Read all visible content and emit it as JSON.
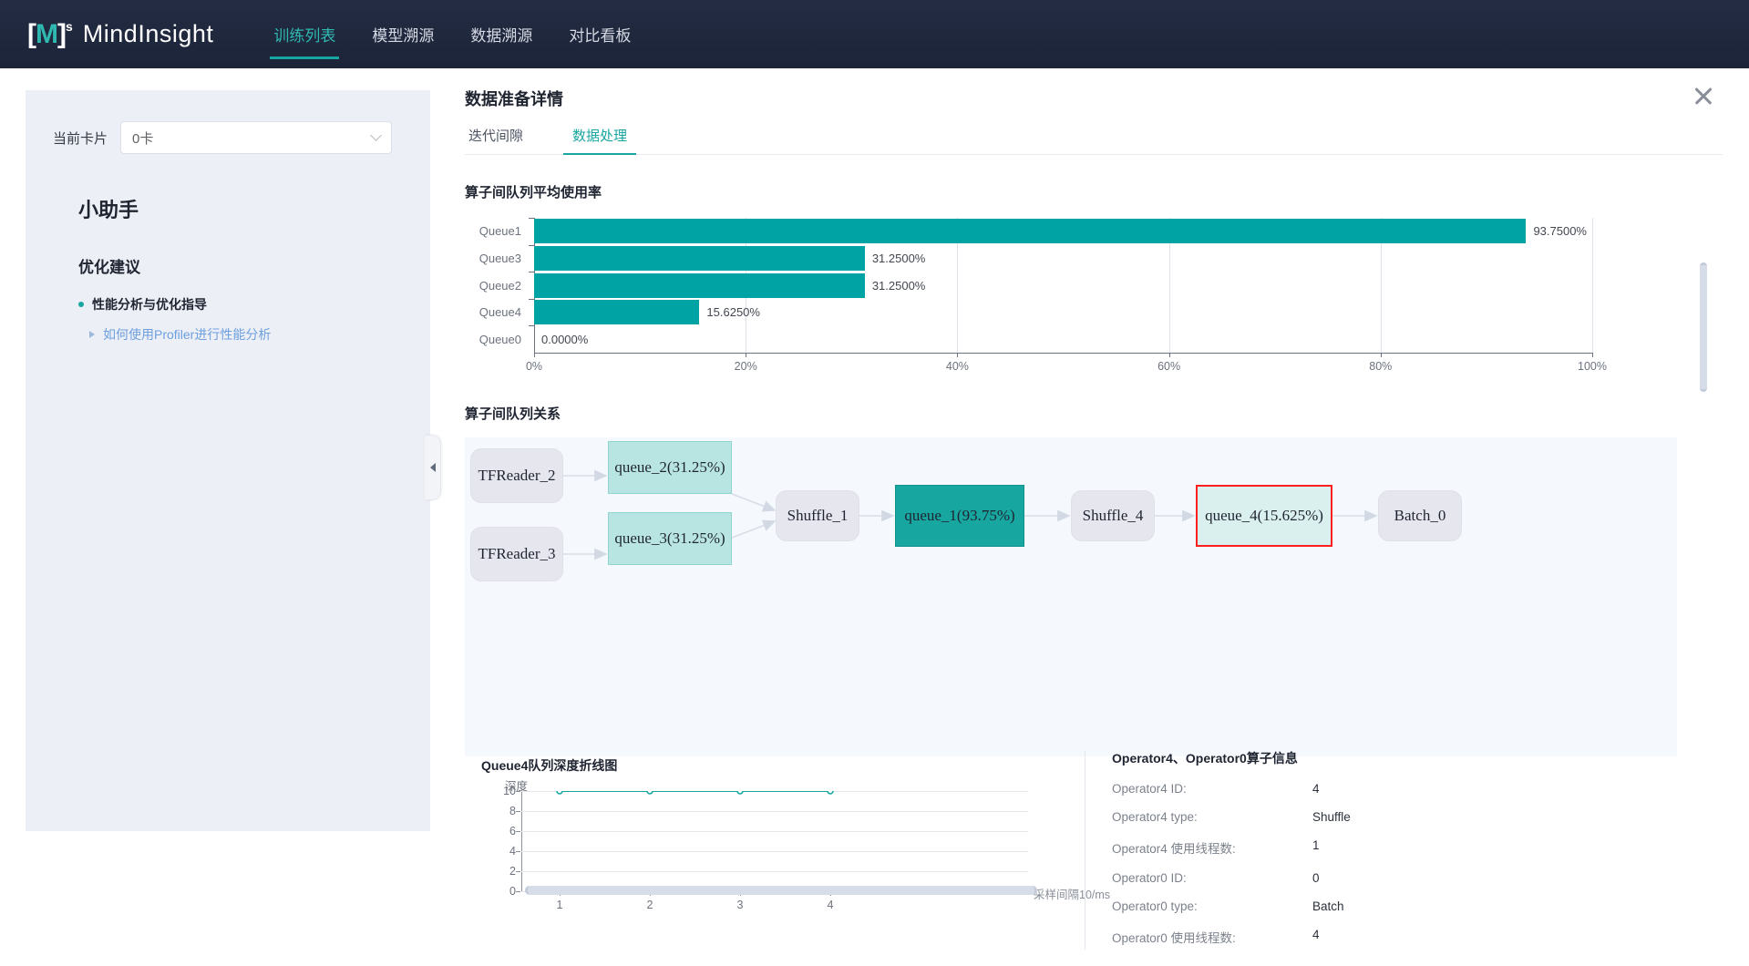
{
  "brand": {
    "logo_bracket_left": "[",
    "logo_m": "M",
    "logo_bracket_right": "]",
    "logo_sup": "s",
    "name": "MindInsight",
    "accent_color": "#17a6a0"
  },
  "nav": {
    "items": [
      {
        "label": "训练列表",
        "active": true
      },
      {
        "label": "模型溯源",
        "active": false
      },
      {
        "label": "数据溯源",
        "active": false
      },
      {
        "label": "对比看板",
        "active": false
      }
    ]
  },
  "sidebar": {
    "card_label": "当前卡片",
    "card_value": "0卡",
    "assistant_title": "小助手",
    "advice_title": "优化建议",
    "advice_group": "性能分析与优化指导",
    "advice_link": "如何使用Profiler进行性能分析"
  },
  "panel": {
    "title": "数据准备详情",
    "close_icon": "close-icon",
    "collapse_icon": "chevron-left-icon",
    "tabs": [
      {
        "label": "迭代间隙",
        "active": false
      },
      {
        "label": "数据处理",
        "active": true
      }
    ]
  },
  "sections": {
    "bar_title": "算子间队列平均使用率",
    "graph_title": "算子间队列关系",
    "line_title": "Queue4队列深度折线图",
    "info_title": "Operator4、Operator0算子信息"
  },
  "chart_data": [
    {
      "type": "bar",
      "title": "算子间队列平均使用率",
      "orientation": "horizontal",
      "categories": [
        "Queue1",
        "Queue3",
        "Queue2",
        "Queue4",
        "Queue0"
      ],
      "values": [
        93.75,
        31.25,
        31.25,
        15.625,
        0.0
      ],
      "value_labels": [
        "93.7500%",
        "31.2500%",
        "31.2500%",
        "15.6250%",
        "0.0000%"
      ],
      "xlabel": "",
      "ylabel": "",
      "xlim": [
        0,
        100
      ],
      "xticks": [
        0,
        20,
        40,
        60,
        80,
        100
      ],
      "xtick_labels": [
        "0%",
        "20%",
        "40%",
        "60%",
        "80%",
        "100%"
      ],
      "grid": true,
      "bar_color": "#00a3a4"
    },
    {
      "type": "line",
      "title": "Queue4队列深度折线图",
      "ylabel": "深度",
      "xlabel": "采样间隔10/ms",
      "x": [
        1,
        2,
        3,
        4
      ],
      "values": [
        10,
        10,
        10,
        10
      ],
      "ylim": [
        0,
        10
      ],
      "yticks": [
        0,
        2,
        4,
        6,
        8,
        10
      ],
      "ytick_labels": [
        "0",
        "2",
        "4",
        "6",
        "8",
        "10"
      ],
      "xticks": [
        1,
        2,
        3,
        4
      ],
      "xtick_labels": [
        "1",
        "2",
        "3",
        "4"
      ],
      "grid": true,
      "line_color": "#17a6a0"
    }
  ],
  "graph": {
    "nodes": [
      {
        "id": "tfreader_2",
        "label": "TFReader_2",
        "kind": "op"
      },
      {
        "id": "tfreader_3",
        "label": "TFReader_3",
        "kind": "op"
      },
      {
        "id": "queue_2",
        "label": "queue_2(31.25%)",
        "kind": "queue-light"
      },
      {
        "id": "queue_3",
        "label": "queue_3(31.25%)",
        "kind": "queue-light"
      },
      {
        "id": "shuffle_1",
        "label": "Shuffle_1",
        "kind": "op"
      },
      {
        "id": "queue_1",
        "label": "queue_1(93.75%)",
        "kind": "queue-dark"
      },
      {
        "id": "shuffle_4",
        "label": "Shuffle_4",
        "kind": "op"
      },
      {
        "id": "queue_4",
        "label": "queue_4(15.625%)",
        "kind": "queue-selected"
      },
      {
        "id": "batch_0",
        "label": "Batch_0",
        "kind": "op"
      }
    ]
  },
  "info": {
    "title": "Operator4、Operator0算子信息",
    "rows": [
      {
        "key": "Operator4 ID:",
        "value": "4"
      },
      {
        "key": "Operator4 type:",
        "value": "Shuffle"
      },
      {
        "key": "Operator4 使用线程数:",
        "value": "1"
      },
      {
        "key": "Operator0 ID:",
        "value": "0"
      },
      {
        "key": "Operator0 type:",
        "value": "Batch"
      },
      {
        "key": "Operator0 使用线程数:",
        "value": "4"
      }
    ]
  }
}
